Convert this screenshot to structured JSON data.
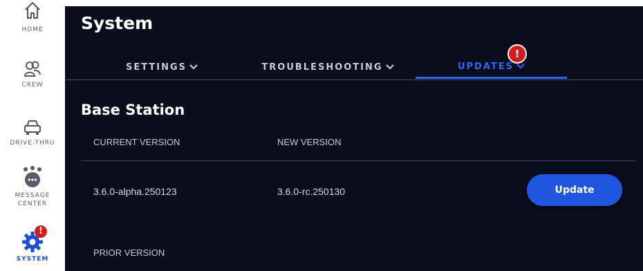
{
  "sidebar": {
    "items": [
      {
        "label": "HOME",
        "icon": "home-icon"
      },
      {
        "label": "CREW",
        "icon": "crew-icon"
      },
      {
        "label": "DRIVE-THRU",
        "icon": "car-icon"
      },
      {
        "label": "MESSAGE\nCENTER",
        "icon": "message-center-icon"
      },
      {
        "label": "SYSTEM",
        "icon": "gear-icon",
        "active": true,
        "badge": "!"
      }
    ]
  },
  "page": {
    "title": "System"
  },
  "tabs": [
    {
      "label": "SETTINGS",
      "icon": "chevron-down-icon"
    },
    {
      "label": "TROUBLESHOOTING",
      "icon": "chevron-down-icon"
    },
    {
      "label": "UPDATES",
      "icon": "chevron-down-icon",
      "active": true,
      "badge": "!"
    }
  ],
  "base_station": {
    "title": "Base Station",
    "headers": {
      "current": "CURRENT VERSION",
      "new": "NEW VERSION"
    },
    "current_version": "3.6.0-alpha.250123",
    "new_version": "3.6.0-rc.250130",
    "update_label": "Update",
    "prior_version_label": "PRIOR VERSION"
  },
  "colors": {
    "background": "#0a0d1c",
    "accent": "#2a66ff",
    "button": "#1f55e0",
    "alert": "#d61b1b",
    "sidebar_active": "#1a4fd6"
  }
}
